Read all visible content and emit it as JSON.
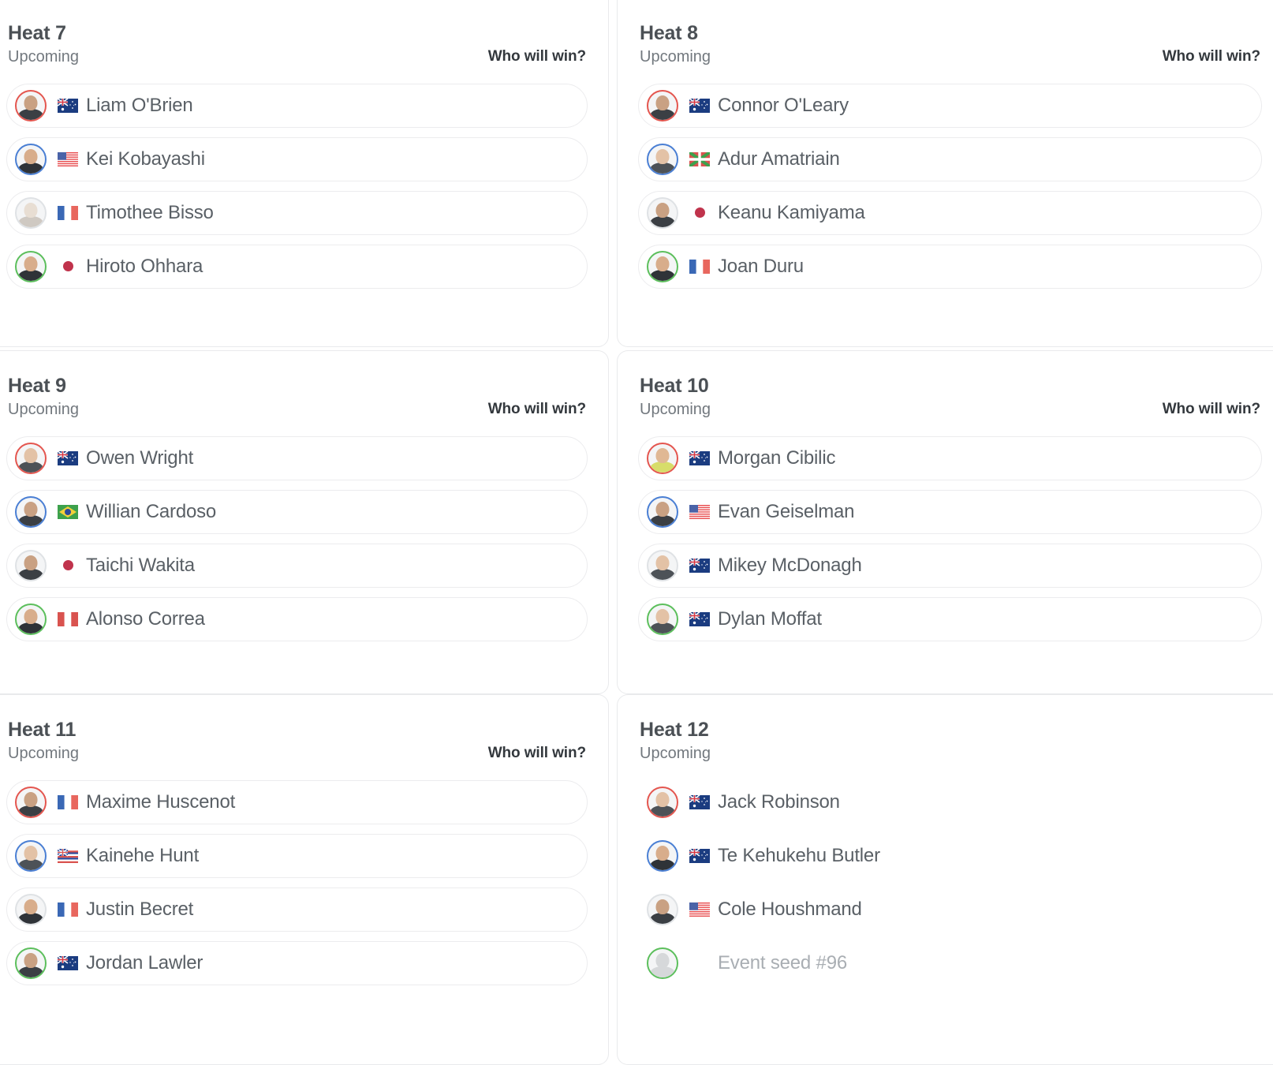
{
  "labels": {
    "status_upcoming": "Upcoming",
    "who_will_win": "Who will win?"
  },
  "colors": {
    "jersey_red": "#e4564f",
    "jersey_blue": "#4a7fd4",
    "jersey_white": "#dfe2e5",
    "jersey_green": "#5cbf5c",
    "card_border": "#e9eaec",
    "row_border": "#ececee",
    "title_text": "#4b5055",
    "status_text": "#72787e",
    "name_text": "#5a6066",
    "placeholder_text": "#a9aeb3",
    "who_will_win_text": "#33383d"
  },
  "heats": [
    {
      "title": "Heat 7",
      "status": "Upcoming",
      "who_will_win": "Who will win?",
      "show_who_will_win": true,
      "rows_pill": true,
      "athletes": [
        {
          "name": "Liam O'Brien",
          "flag": "AU",
          "flag_icon": "flag-australia",
          "jersey": "red",
          "portrait": "dark",
          "placeholder": false
        },
        {
          "name": "Kei Kobayashi",
          "flag": "US",
          "flag_icon": "flag-united-states",
          "jersey": "blue",
          "portrait": "tan",
          "placeholder": false
        },
        {
          "name": "Timothee Bisso",
          "flag": "FR",
          "flag_icon": "flag-france",
          "jersey": "white",
          "portrait": "faded",
          "placeholder": false
        },
        {
          "name": "Hiroto Ohhara",
          "flag": "JP",
          "flag_icon": "flag-japan",
          "jersey": "green",
          "portrait": "tan",
          "placeholder": false
        }
      ]
    },
    {
      "title": "Heat 8",
      "status": "Upcoming",
      "who_will_win": "Who will win?",
      "show_who_will_win": true,
      "rows_pill": true,
      "athletes": [
        {
          "name": "Connor O'Leary",
          "flag": "AU",
          "flag_icon": "flag-australia",
          "jersey": "red",
          "portrait": "dark",
          "placeholder": false
        },
        {
          "name": "Adur Amatriain",
          "flag": "EH",
          "flag_icon": "flag-basque",
          "jersey": "blue",
          "portrait": "light",
          "placeholder": false
        },
        {
          "name": "Keanu Kamiyama",
          "flag": "JP",
          "flag_icon": "flag-japan",
          "jersey": "white",
          "portrait": "dark",
          "placeholder": false
        },
        {
          "name": "Joan Duru",
          "flag": "FR",
          "flag_icon": "flag-france",
          "jersey": "green",
          "portrait": "tan",
          "placeholder": false
        }
      ]
    },
    {
      "title": "Heat 9",
      "status": "Upcoming",
      "who_will_win": "Who will win?",
      "show_who_will_win": true,
      "rows_pill": true,
      "athletes": [
        {
          "name": "Owen Wright",
          "flag": "AU",
          "flag_icon": "flag-australia",
          "jersey": "red",
          "portrait": "light",
          "placeholder": false
        },
        {
          "name": "Willian Cardoso",
          "flag": "BR",
          "flag_icon": "flag-brazil",
          "jersey": "blue",
          "portrait": "dark",
          "placeholder": false
        },
        {
          "name": "Taichi Wakita",
          "flag": "JP",
          "flag_icon": "flag-japan",
          "jersey": "white",
          "portrait": "dark",
          "placeholder": false
        },
        {
          "name": "Alonso Correa",
          "flag": "PE",
          "flag_icon": "flag-peru",
          "jersey": "green",
          "portrait": "tan",
          "placeholder": false
        }
      ]
    },
    {
      "title": "Heat 10",
      "status": "Upcoming",
      "who_will_win": "Who will win?",
      "show_who_will_win": true,
      "rows_pill": true,
      "athletes": [
        {
          "name": "Morgan Cibilic",
          "flag": "AU",
          "flag_icon": "flag-australia",
          "jersey": "red",
          "portrait": "yellow",
          "placeholder": false
        },
        {
          "name": "Evan Geiselman",
          "flag": "US",
          "flag_icon": "flag-united-states",
          "jersey": "blue",
          "portrait": "dark",
          "placeholder": false
        },
        {
          "name": "Mikey McDonagh",
          "flag": "AU",
          "flag_icon": "flag-australia",
          "jersey": "white",
          "portrait": "light",
          "placeholder": false
        },
        {
          "name": "Dylan Moffat",
          "flag": "AU",
          "flag_icon": "flag-australia",
          "jersey": "green",
          "portrait": "light",
          "placeholder": false
        }
      ]
    },
    {
      "title": "Heat 11",
      "status": "Upcoming",
      "who_will_win": "Who will win?",
      "show_who_will_win": true,
      "rows_pill": true,
      "athletes": [
        {
          "name": "Maxime Huscenot",
          "flag": "FR",
          "flag_icon": "flag-france",
          "jersey": "red",
          "portrait": "dark",
          "placeholder": false
        },
        {
          "name": "Kainehe Hunt",
          "flag": "HI",
          "flag_icon": "flag-hawaii",
          "jersey": "blue",
          "portrait": "light",
          "placeholder": false
        },
        {
          "name": "Justin Becret",
          "flag": "FR",
          "flag_icon": "flag-france",
          "jersey": "white",
          "portrait": "tan",
          "placeholder": false
        },
        {
          "name": "Jordan Lawler",
          "flag": "AU",
          "flag_icon": "flag-australia",
          "jersey": "green",
          "portrait": "dark",
          "placeholder": false
        }
      ]
    },
    {
      "title": "Heat 12",
      "status": "Upcoming",
      "who_will_win": "",
      "show_who_will_win": false,
      "rows_pill": false,
      "athletes": [
        {
          "name": "Jack Robinson",
          "flag": "AU",
          "flag_icon": "flag-australia",
          "jersey": "red",
          "portrait": "light",
          "placeholder": false
        },
        {
          "name": "Te Kehukehu Butler",
          "flag": "AU",
          "flag_icon": "flag-australia",
          "jersey": "blue",
          "portrait": "tan",
          "placeholder": false
        },
        {
          "name": "Cole Houshmand",
          "flag": "US",
          "flag_icon": "flag-united-states",
          "jersey": "white",
          "portrait": "dark",
          "placeholder": false
        },
        {
          "name": "Event seed #96",
          "flag": "",
          "flag_icon": "",
          "jersey": "green",
          "portrait": "placeholder",
          "placeholder": true
        }
      ]
    }
  ]
}
